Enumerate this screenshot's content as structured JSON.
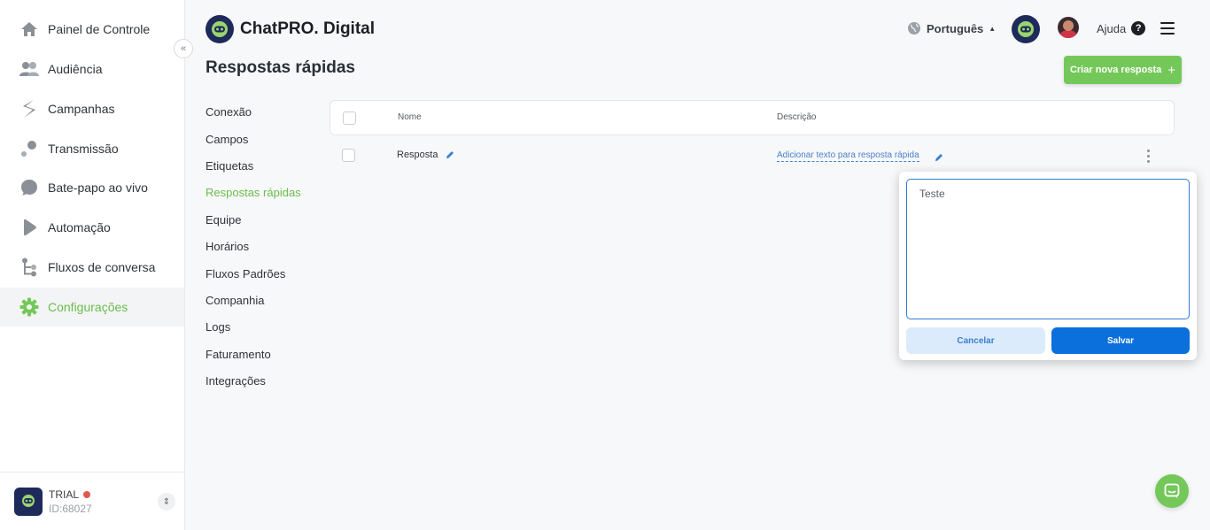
{
  "sidebar": {
    "items": [
      {
        "label": "Painel de Controle",
        "icon": "home-icon"
      },
      {
        "label": "Audiência",
        "icon": "people-icon"
      },
      {
        "label": "Campanhas",
        "icon": "campaign-icon"
      },
      {
        "label": "Transmissão",
        "icon": "broadcast-icon"
      },
      {
        "label": "Bate-papo ao vivo",
        "icon": "chat-bubble-icon"
      },
      {
        "label": "Automação",
        "icon": "automation-icon"
      },
      {
        "label": "Fluxos de conversa",
        "icon": "flow-icon"
      },
      {
        "label": "Configurações",
        "icon": "gear-icon",
        "active": true
      }
    ],
    "account": {
      "plan": "TRIAL",
      "id": "ID:68027"
    }
  },
  "header": {
    "brand": "ChatPRO. Digital",
    "language": "Português",
    "help": "Ajuda"
  },
  "page": {
    "title": "Respostas rápidas",
    "create_button": "Criar nova resposta"
  },
  "settings_menu": [
    {
      "label": "Conexão"
    },
    {
      "label": "Campos"
    },
    {
      "label": "Etiquetas"
    },
    {
      "label": "Respostas rápidas",
      "active": true
    },
    {
      "label": "Equipe"
    },
    {
      "label": "Horários"
    },
    {
      "label": "Fluxos Padrões"
    },
    {
      "label": "Companhia"
    },
    {
      "label": "Logs"
    },
    {
      "label": "Faturamento"
    },
    {
      "label": "Integrações"
    }
  ],
  "table": {
    "columns": [
      "Nome",
      "Descrição"
    ],
    "rows": [
      {
        "name": "Resposta",
        "description": "Adicionar texto para resposta rápida"
      }
    ]
  },
  "popover": {
    "text": "Teste",
    "cancel": "Cancelar",
    "save": "Salvar"
  },
  "colors": {
    "accent_green": "#74c859",
    "primary_blue": "#0b6fdc",
    "brand_navy": "#1e2a5a"
  }
}
